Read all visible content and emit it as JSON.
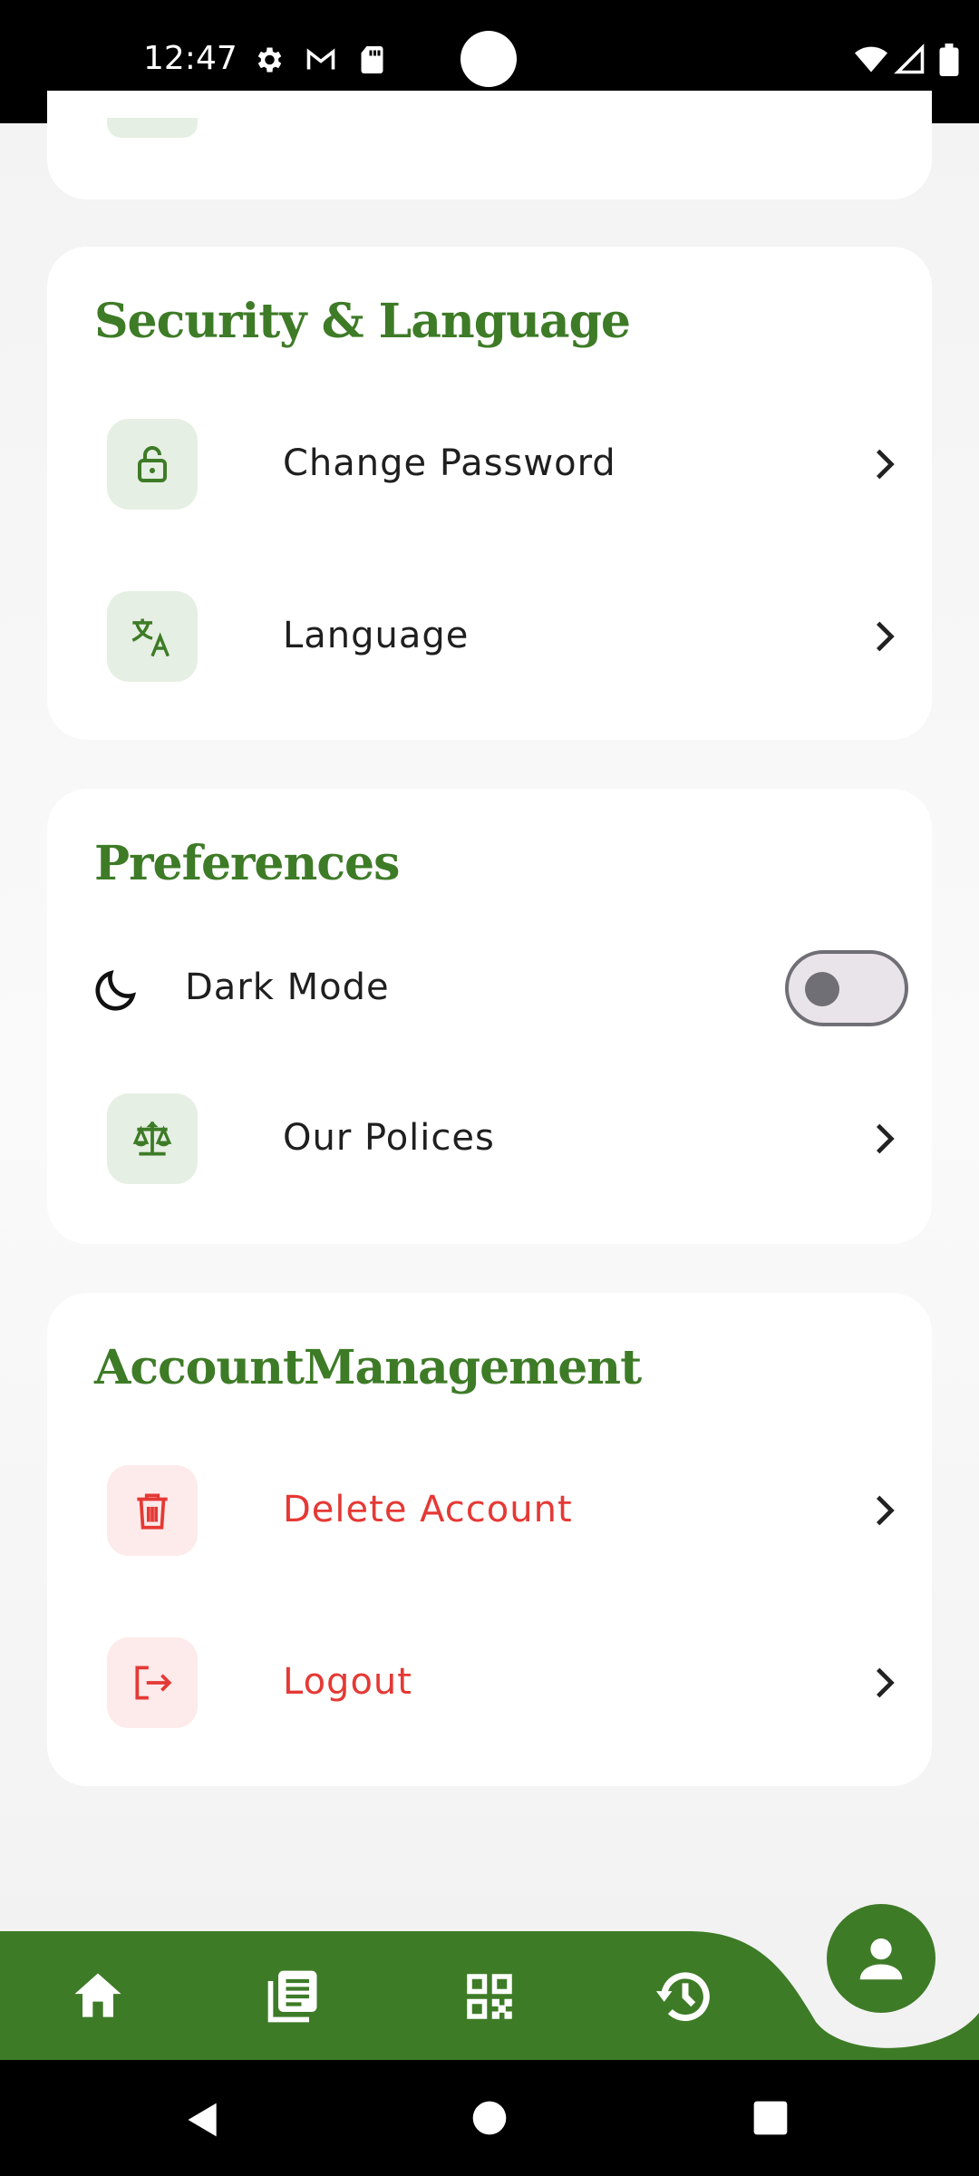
{
  "status_bar": {
    "time": "12:47",
    "icons": [
      "gear-icon",
      "gmail-icon",
      "sd-card-icon",
      "wifi-icon",
      "signal-icon",
      "battery-icon"
    ]
  },
  "sections": {
    "security": {
      "title": "Security & Language",
      "items": [
        {
          "label": "Change Password",
          "icon": "lock-icon"
        },
        {
          "label": "Language",
          "icon": "translate-icon"
        }
      ]
    },
    "preferences": {
      "title": "Preferences",
      "dark_mode_label": "Dark Mode",
      "dark_mode_on": false,
      "items": [
        {
          "label": "Our Polices",
          "icon": "balance-scale-icon"
        }
      ]
    },
    "account": {
      "title": "AccountManagement",
      "items": [
        {
          "label": "Delete Account",
          "icon": "trash-icon"
        },
        {
          "label": "Logout",
          "icon": "logout-icon"
        }
      ]
    }
  },
  "bottom_nav": {
    "items": [
      "home-icon",
      "news-icon",
      "qr-code-icon",
      "history-icon",
      "profile-icon"
    ],
    "active": "profile-icon"
  },
  "colors": {
    "brand_green": "#3e7b27",
    "danger_red": "#e53935",
    "icon_bg_green": "#e6efe3",
    "icon_bg_red": "#fdeaea"
  }
}
